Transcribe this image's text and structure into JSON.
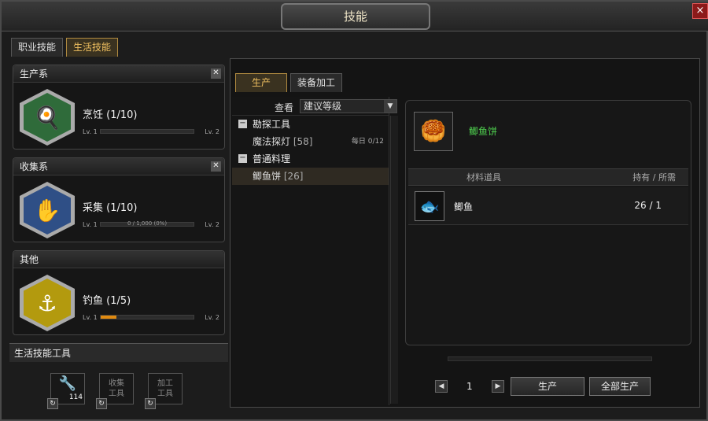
{
  "window": {
    "title": "技能",
    "close_label": "×"
  },
  "top_tabs": [
    {
      "label": "职业技能",
      "active": false
    },
    {
      "label": "生活技能",
      "active": true
    }
  ],
  "skill_groups": [
    {
      "header": "生产系",
      "skill_name": "烹饪  (1/10)",
      "icon": "cooking-utensils-icon",
      "icon_color": "#2f6b3a",
      "lv_left": "Lv. 1",
      "lv_right": "Lv. 2",
      "progress_text": "",
      "progress_fraction": 0
    },
    {
      "header": "收集系",
      "skill_name": "采集  (1/10)",
      "icon": "gathering-glove-icon",
      "icon_color": "#2f4f86",
      "lv_left": "Lv. 1",
      "lv_right": "Lv. 2",
      "progress_text": "0 / 1,000 (0%)",
      "progress_fraction": 0
    },
    {
      "header": "其他",
      "skill_name": "钓鱼  (1/5)",
      "icon": "fishing-hook-icon",
      "icon_color": "#b39a0e",
      "lv_left": "Lv. 1",
      "lv_right": "Lv. 2",
      "progress_text": "",
      "progress_fraction": 0.17
    }
  ],
  "tools": {
    "header": "生活技能工具",
    "slots": [
      {
        "label": "",
        "count": "114",
        "icon": "tool-item-icon"
      },
      {
        "label": "收集\n工具",
        "count": ""
      },
      {
        "label": "加工\n工具",
        "count": ""
      }
    ],
    "refresh_icon": "↻"
  },
  "sub_tabs": [
    {
      "label": "生产",
      "active": true
    },
    {
      "label": "装备加工",
      "active": false
    }
  ],
  "recipe_list": {
    "view_label": "查看",
    "view_value": "建议等级",
    "categories": [
      {
        "name": "勘探工具",
        "items": [
          {
            "name": "魔法探灯",
            "count": "[58]",
            "daily": "每日 0/12"
          }
        ]
      },
      {
        "name": "普通料理",
        "items": [
          {
            "name": "鲫鱼饼",
            "count": "[26]",
            "daily": ""
          }
        ]
      }
    ]
  },
  "detail": {
    "item_name": "鲫鱼饼",
    "item_icon": "fish-cake-icon",
    "materials_header": "材料道具",
    "qty_header": "持有 / 所需",
    "materials": [
      {
        "name": "鲫鱼",
        "icon": "fish-icon",
        "qty": "26 / 1"
      }
    ]
  },
  "bottom": {
    "page": "1",
    "prev": "◀",
    "next": "▶",
    "produce_label": "生产",
    "produce_all_label": "全部生产"
  },
  "colors": {
    "accent": "#f0c060",
    "item_green": "#4fd24f",
    "xp_orange": "#e08a10"
  }
}
